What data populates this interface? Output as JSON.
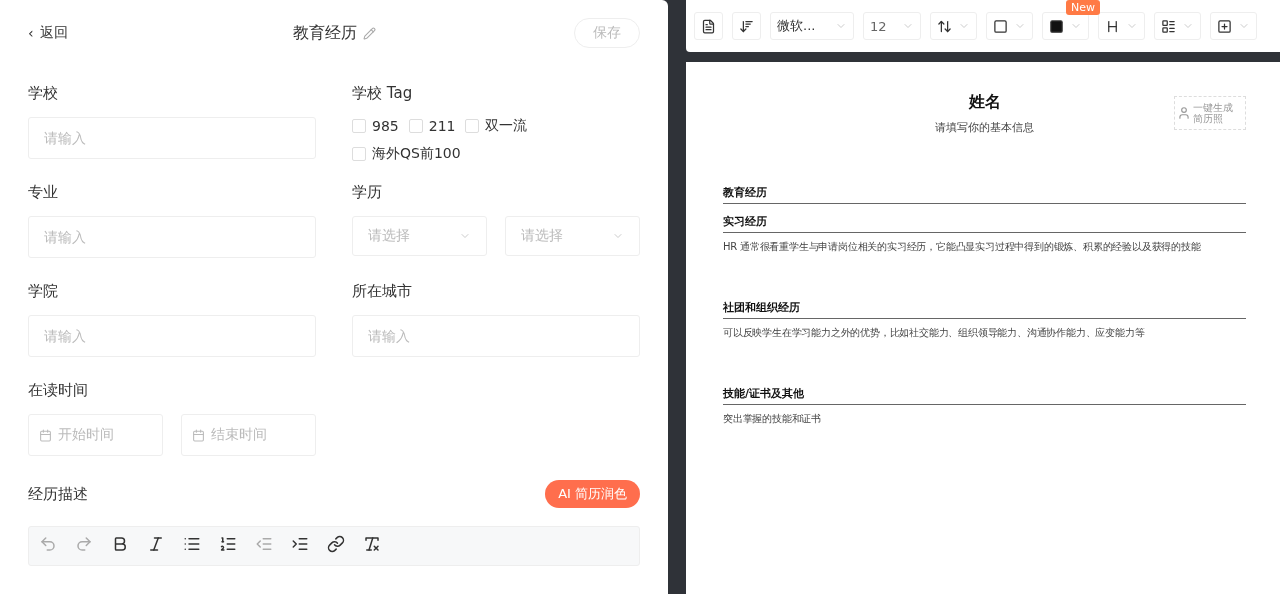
{
  "header": {
    "back": "返回",
    "back_icon": "‹",
    "title": "教育经历",
    "save": "保存"
  },
  "fields": [
    {
      "kind": "input",
      "label": "学校",
      "placeholder": "请输入"
    },
    {
      "kind": "tags",
      "label": "学校 Tag",
      "tags": [
        {
          "label": "985",
          "checked": false
        },
        {
          "label": "211",
          "checked": false
        },
        {
          "label": "双一流",
          "checked": false
        },
        {
          "label": "海外QS前100",
          "checked": false
        }
      ]
    },
    {
      "kind": "input",
      "label": "专业",
      "placeholder": "请输入"
    },
    {
      "kind": "selects",
      "label": "学历",
      "selects": [
        {
          "placeholder": "请选择"
        },
        {
          "placeholder": "请选择"
        }
      ]
    },
    {
      "kind": "input",
      "label": "学院",
      "placeholder": "请输入"
    },
    {
      "kind": "input",
      "label": "所在城市",
      "placeholder": "请输入"
    },
    {
      "kind": "dates",
      "label": "在读时间",
      "dates": [
        {
          "placeholder": "开始时间"
        },
        {
          "placeholder": "结束时间"
        }
      ]
    }
  ],
  "description": {
    "label": "经历描述",
    "ai_button": "AI 简历润色",
    "tools": [
      {
        "kind": "undo",
        "disabled": true
      },
      {
        "kind": "redo",
        "disabled": true
      },
      {
        "kind": "bold",
        "disabled": false
      },
      {
        "kind": "italic",
        "disabled": false
      },
      {
        "kind": "bullets",
        "disabled": false
      },
      {
        "kind": "numbers",
        "disabled": false
      },
      {
        "kind": "outdent",
        "disabled": true
      },
      {
        "kind": "indent",
        "disabled": false
      },
      {
        "kind": "link",
        "disabled": false
      },
      {
        "kind": "clear",
        "disabled": false
      }
    ]
  },
  "toolbar": {
    "font": "微软...",
    "size": "12",
    "badge": "New"
  },
  "resume": {
    "name": "姓名",
    "subtitle": "请填写你的基本信息",
    "photo": "一键生成简历照",
    "sections": [
      {
        "title": "教育经历"
      },
      {
        "title": "实习经历",
        "text": "HR 通常很看重学生与申请岗位相关的实习经历，它能凸显实习过程中得到的锻炼、积累的经验以及获得的技能"
      },
      {
        "title": "社团和组织经历",
        "text": "可以反映学生在学习能力之外的优势，比如社交能力、组织领导能力、沟通协作能力、应变能力等"
      },
      {
        "title": "技能/证书及其他",
        "text": "突出掌握的技能和证书"
      }
    ]
  }
}
